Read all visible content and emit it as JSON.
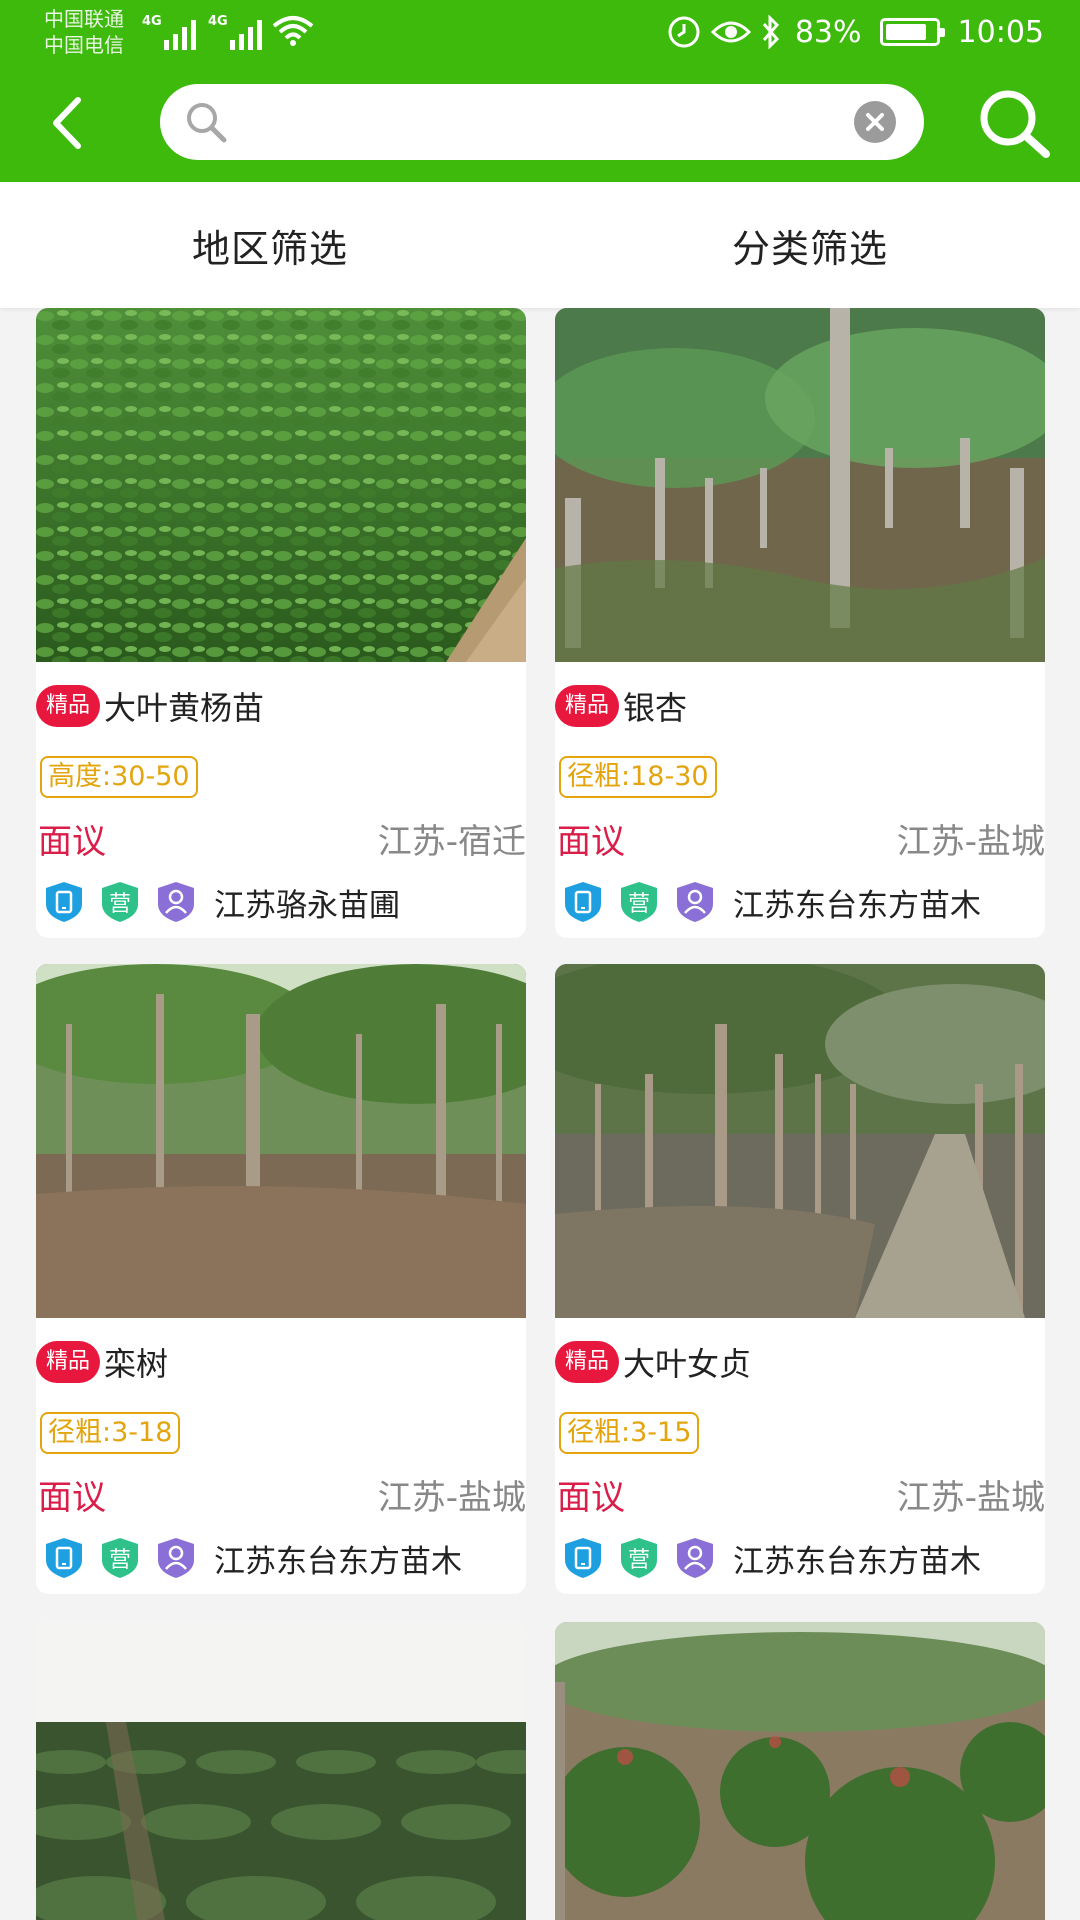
{
  "status": {
    "carrier1": "中国联通",
    "carrier2": "中国电信",
    "net1": "4G",
    "net2": "4G",
    "battery": "83%",
    "time": "10:05"
  },
  "search": {
    "placeholder": "",
    "value": ""
  },
  "filters": [
    "地区筛选",
    "分类筛选"
  ],
  "badge": "精品",
  "cards": [
    {
      "name": "大叶黄杨苗",
      "spec": "高度:30-50",
      "price": "面议",
      "location": "江苏-宿迁",
      "seller": "江苏骆永苗圃",
      "icon_label": "营"
    },
    {
      "name": "银杏",
      "spec": "径粗:18-30",
      "price": "面议",
      "location": "江苏-盐城",
      "seller": "江苏东台东方苗木",
      "icon_label": "营"
    },
    {
      "name": "栾树",
      "spec": "径粗:3-18",
      "price": "面议",
      "location": "江苏-盐城",
      "seller": "江苏东台东方苗木",
      "icon_label": "营"
    },
    {
      "name": "大叶女贞",
      "spec": "径粗:3-15",
      "price": "面议",
      "location": "江苏-盐城",
      "seller": "江苏东台东方苗木",
      "icon_label": "营"
    }
  ],
  "colors": {
    "header": "#3dba0c",
    "badge": "#e8173e",
    "price": "#d91e4a",
    "spec": "#e3a40d",
    "phone_icon": "#1ea0e0",
    "shop_icon": "#2ec28a",
    "user_icon": "#8a6fd6"
  },
  "icons": [
    "back-arrow-icon",
    "search-icon",
    "clear-icon",
    "phone-verified-icon",
    "shop-icon",
    "user-verified-icon"
  ]
}
